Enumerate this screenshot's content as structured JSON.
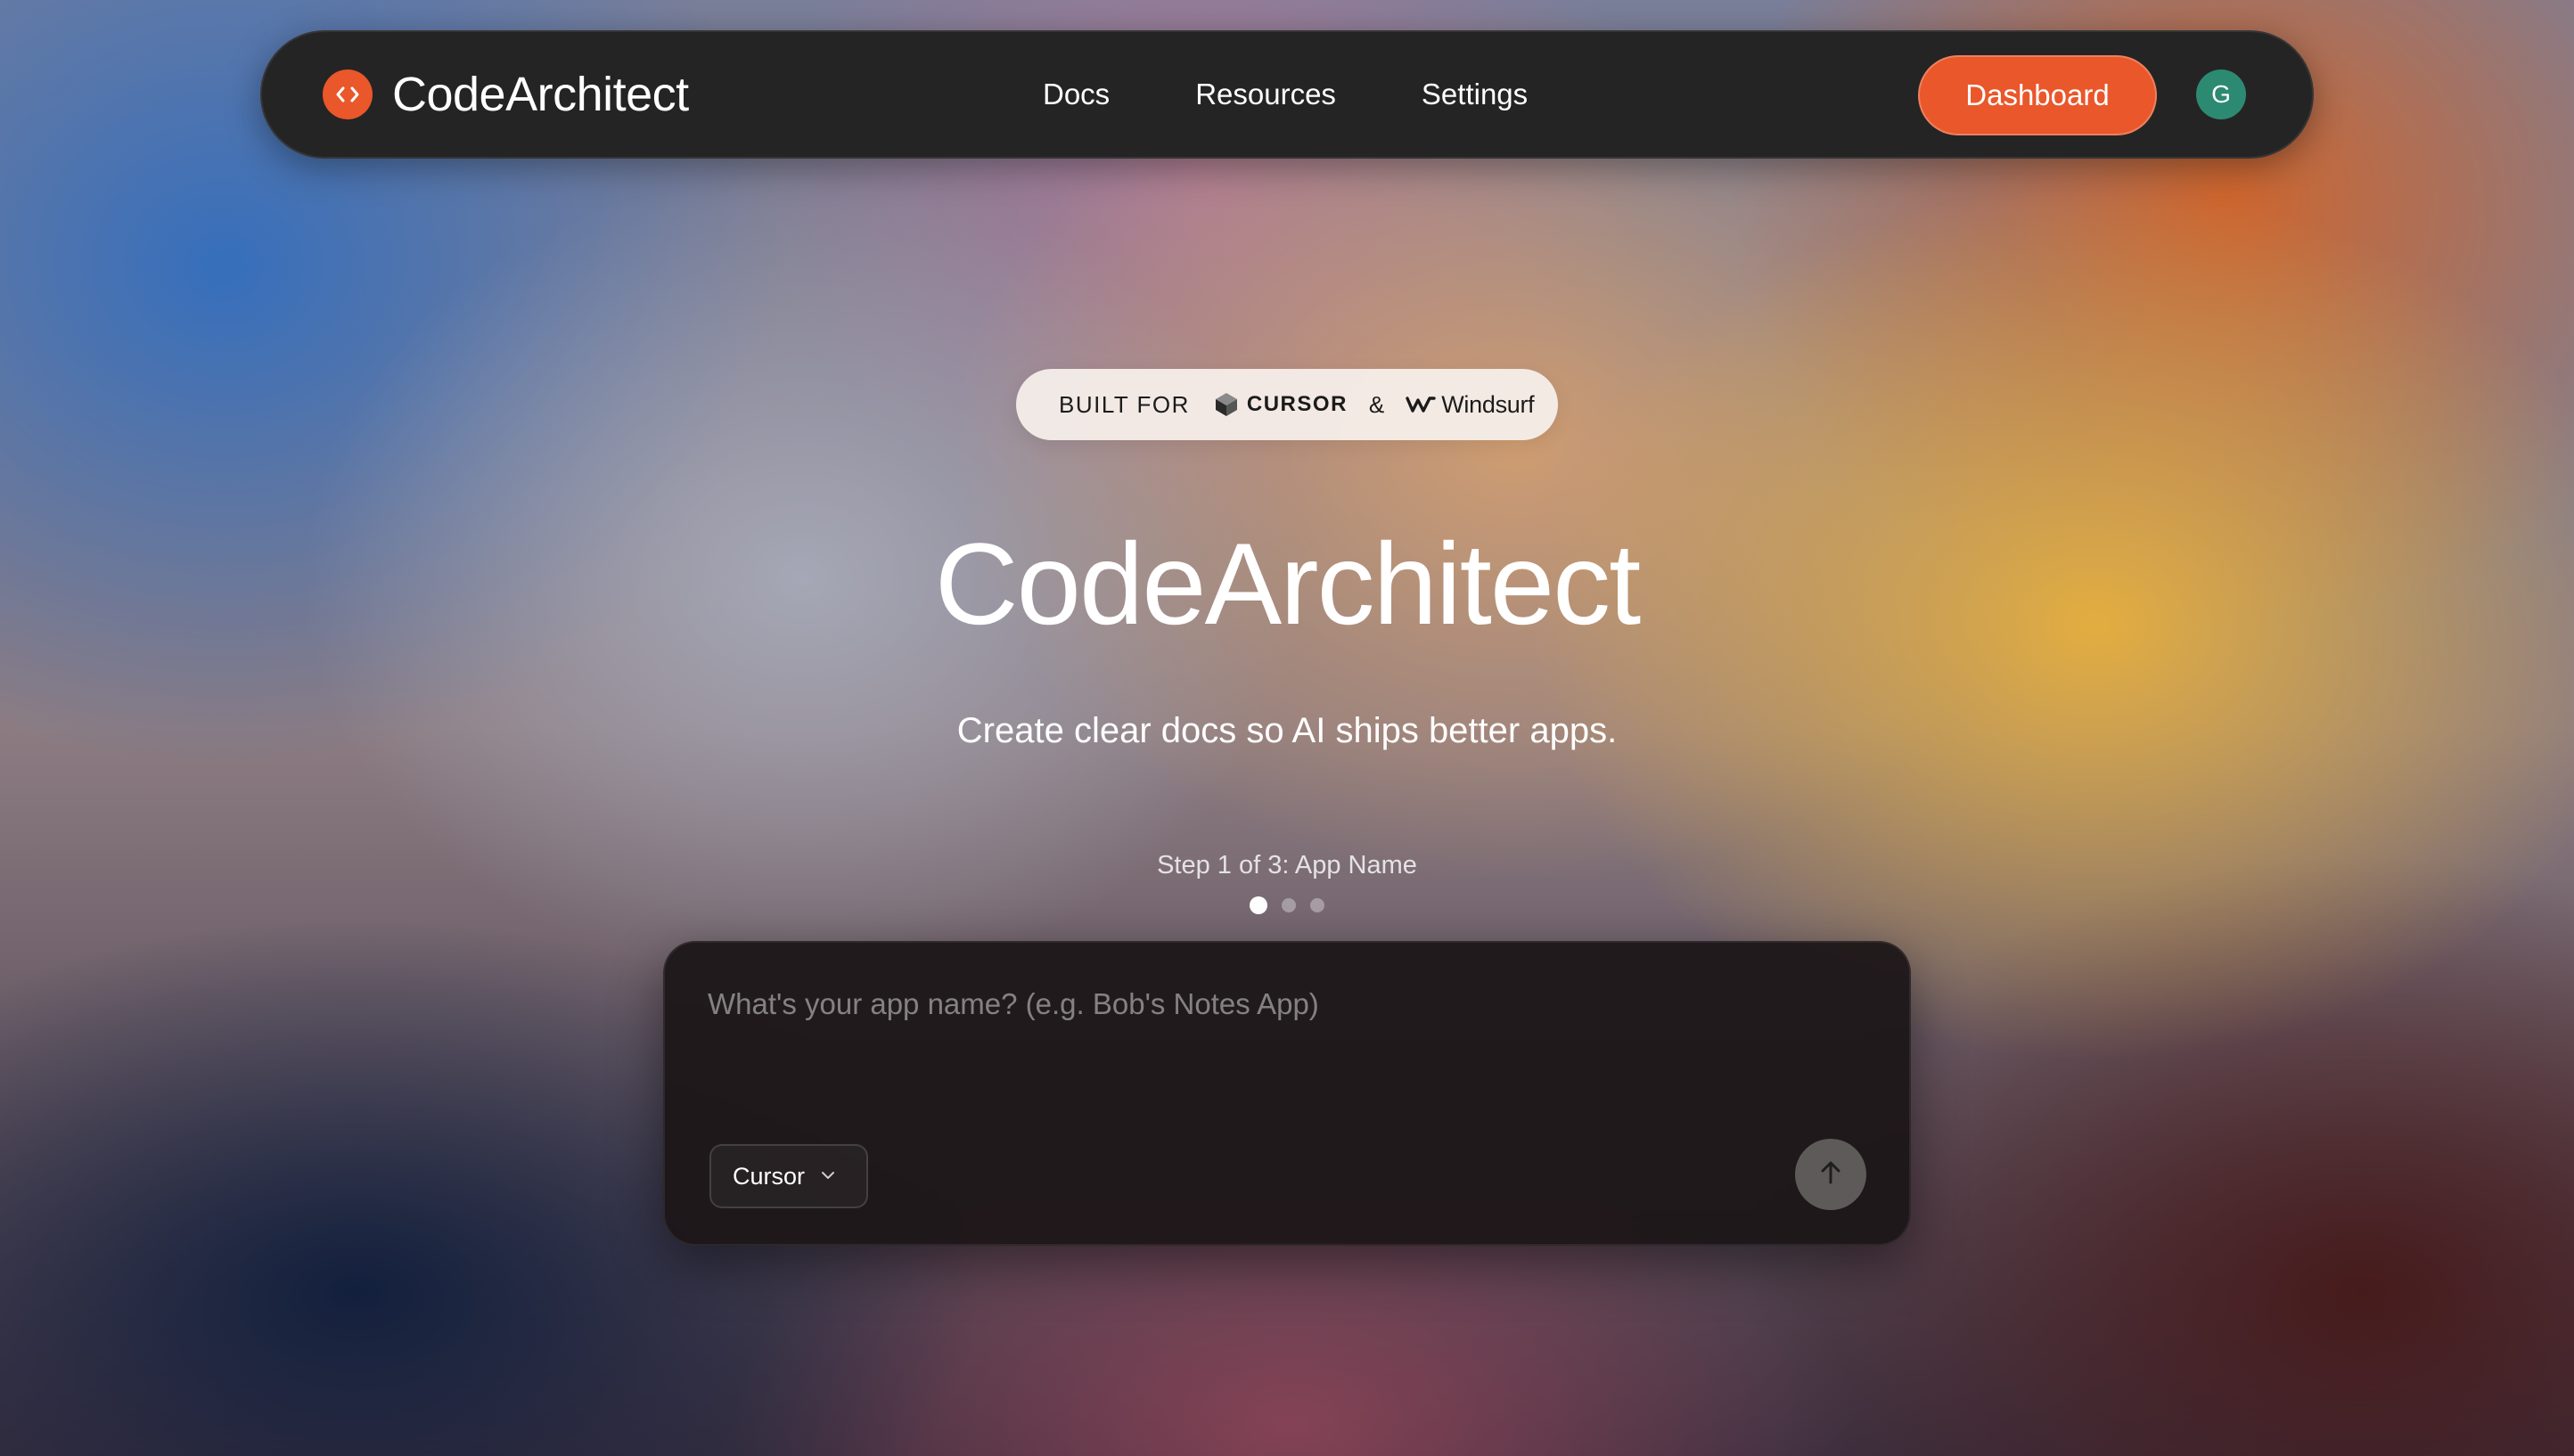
{
  "navbar": {
    "brand_name": "CodeArchitect",
    "links": [
      {
        "label": "Docs"
      },
      {
        "label": "Resources"
      },
      {
        "label": "Settings"
      }
    ],
    "dashboard_label": "Dashboard",
    "avatar_initial": "G"
  },
  "badge": {
    "label": "BUILT FOR",
    "cursor_name": "CURSOR",
    "separator": "&",
    "windsurf_name": "Windsurf"
  },
  "hero": {
    "title": "CodeArchitect",
    "subtitle": "Create clear docs so AI ships better apps."
  },
  "stepper": {
    "label": "Step 1 of 3: App Name",
    "total_steps": 3,
    "current_step": 1
  },
  "input_card": {
    "placeholder": "What's your app name? (e.g. Bob's Notes App)",
    "value": "",
    "ide_selected": "Cursor"
  },
  "icons": {
    "brand": "code-brackets-icon",
    "cursor": "cursor-cube-icon",
    "windsurf": "windsurf-wave-icon",
    "dropdown": "chevron-down-icon",
    "submit": "arrow-up-icon"
  },
  "colors": {
    "accent": "#e9572b",
    "avatar": "#2d8a72",
    "navbar_bg": "#252424",
    "card_bg": "#1c1618",
    "submit_bg": "#5e5a5a"
  }
}
